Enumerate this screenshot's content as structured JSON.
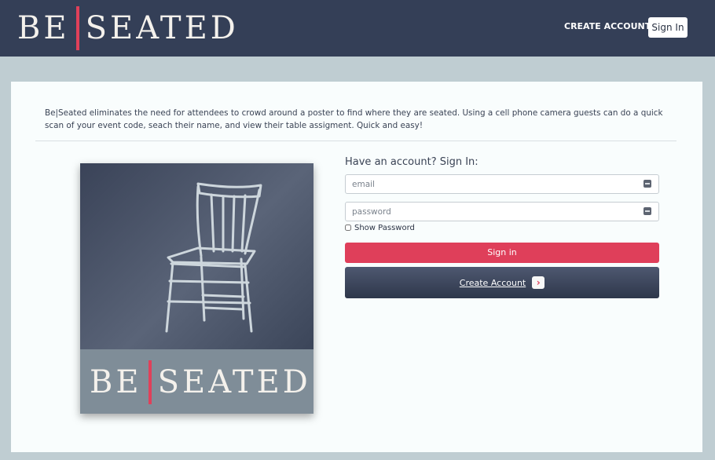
{
  "header": {
    "logo_left": "BE",
    "logo_right": "SEATED",
    "nav_create_account": "CREATE ACCOUNT",
    "nav_sign_in": "Sign In"
  },
  "intro": {
    "text": "Be|Seated eliminates the need for attendees to crowd around a poster to find where they are seated. Using a cell phone camera guests can do a quick scan of your event code, seach their name, and view their table assigment. Quick and easy!"
  },
  "hero": {
    "logo_left": "BE",
    "logo_right": "SEATED"
  },
  "form": {
    "title": "Have an account? Sign In:",
    "email_placeholder": "email",
    "password_placeholder": "password",
    "show_password_label": "Show Password",
    "sign_in_label": "Sign in",
    "create_account_label": "Create Account",
    "create_account_icon": "chevron-right-icon"
  },
  "colors": {
    "header_bg": "#343f57",
    "accent": "#df3f5a",
    "page_bg": "#bfcdd2",
    "card_bg": "#f9fdfd"
  }
}
